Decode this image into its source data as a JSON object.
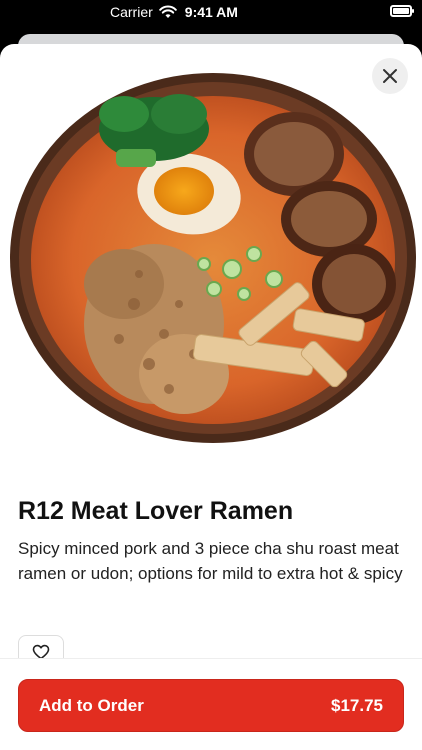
{
  "status_bar": {
    "carrier": "Carrier",
    "time": "9:41 AM"
  },
  "item": {
    "title": "R12 Meat Lover Ramen",
    "description": "Spicy minced pork and 3 piece cha shu roast meat ramen or udon; options for mild to extra hot & spicy"
  },
  "actions": {
    "add_label": "Add to Order",
    "price": "$17.75"
  },
  "icons": {
    "close": "close-icon",
    "favorite": "heart-icon",
    "wifi": "wifi-icon",
    "battery": "battery-icon"
  },
  "colors": {
    "accent": "#e22d20",
    "broth": "#d9652a",
    "bowl": "#4a2a1a"
  }
}
